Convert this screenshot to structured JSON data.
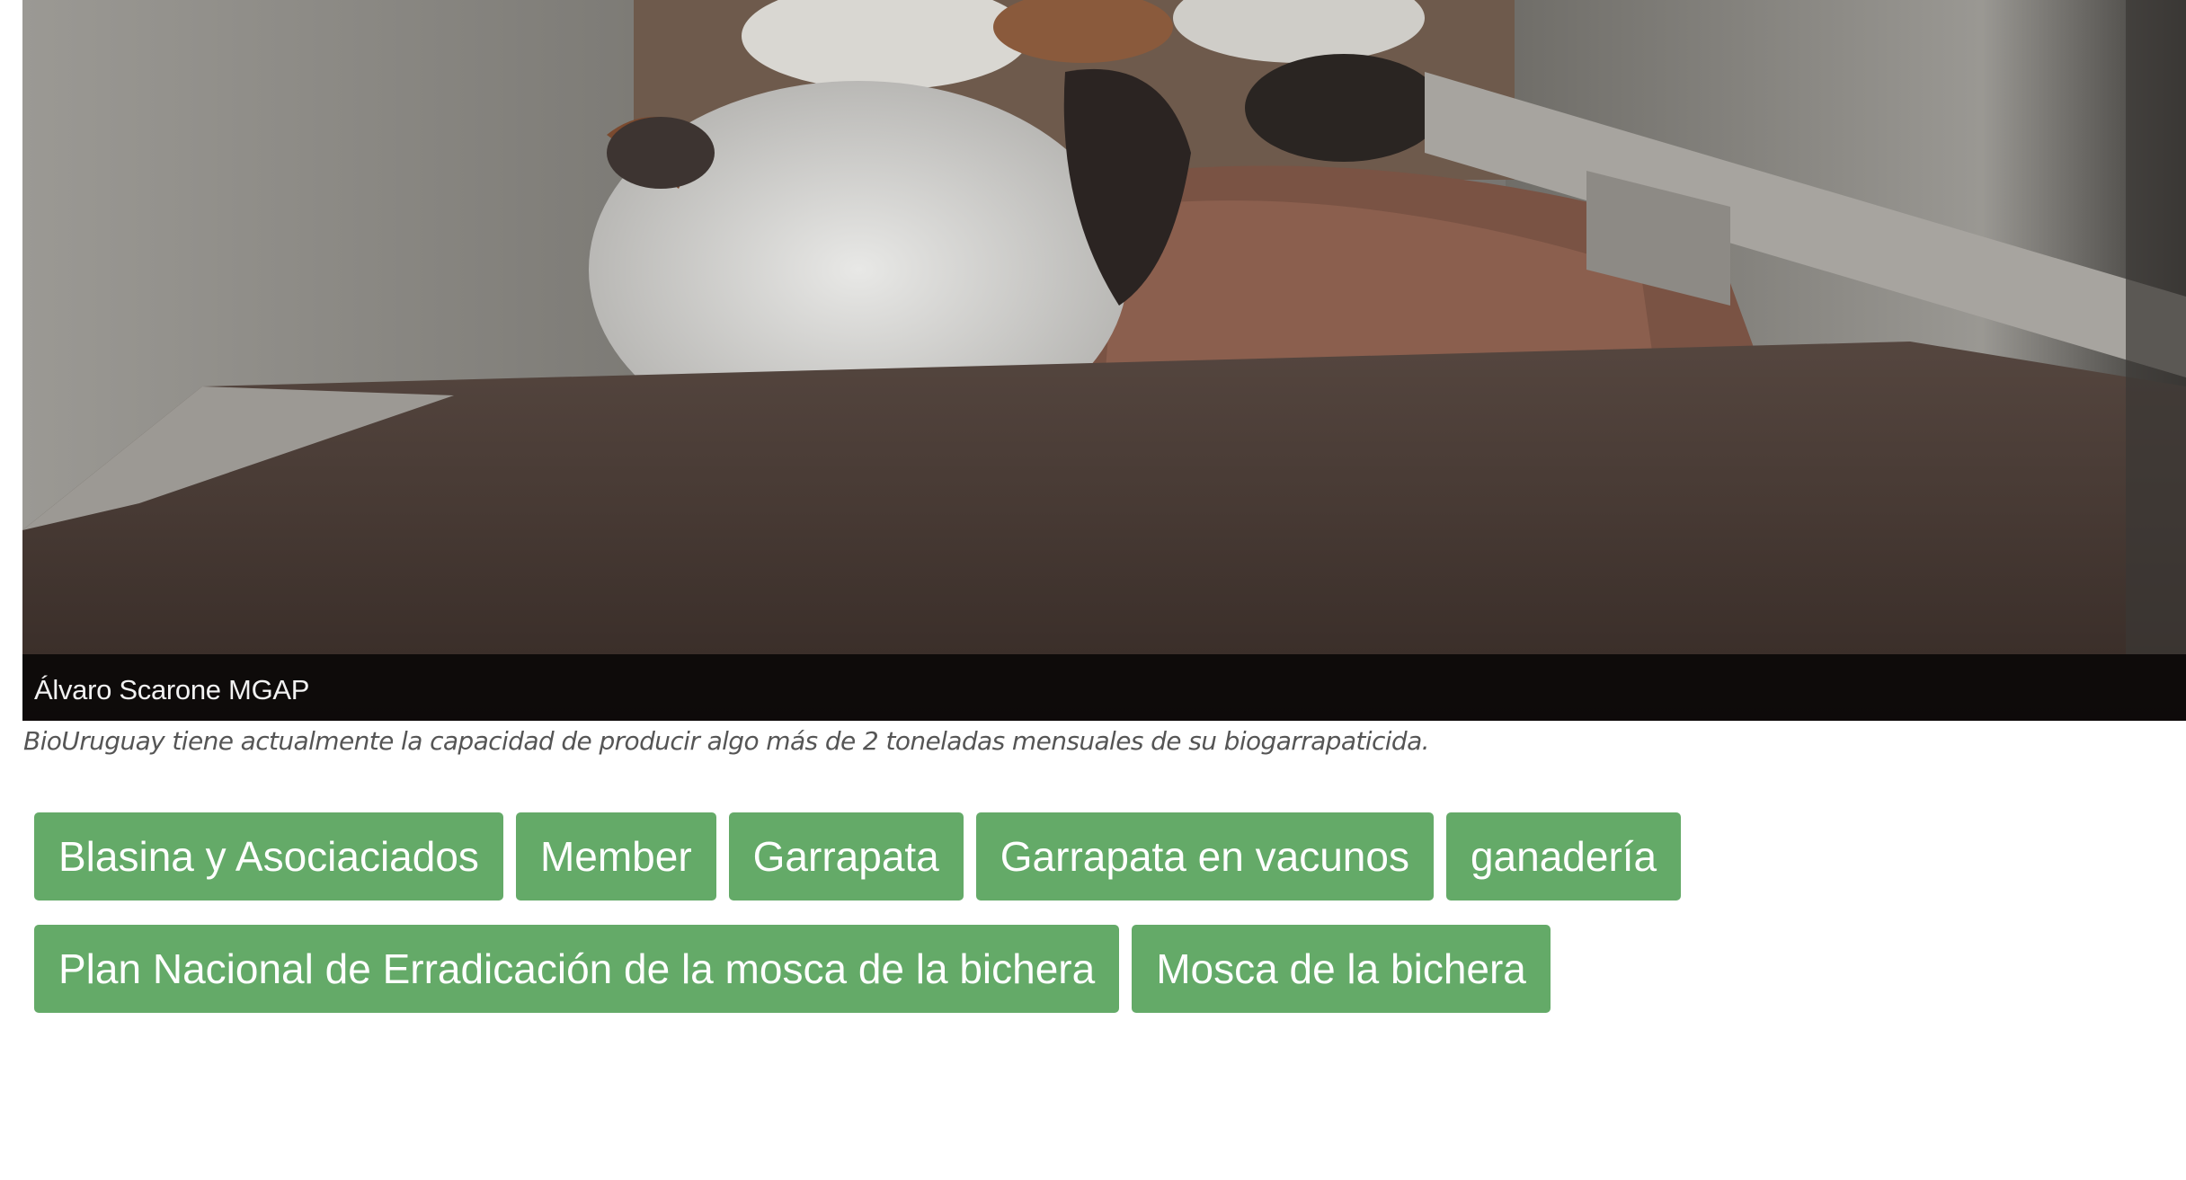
{
  "photo": {
    "credit": "Álvaro Scarone MGAP"
  },
  "caption": "BioUruguay tiene actualmente la capacidad de producir algo más de 2 toneladas mensuales de su biogarrapaticida.",
  "tags": {
    "row1": [
      "Blasina y Asociaciados",
      "Member",
      "Garrapata",
      "Garrapata en vacunos",
      "ganadería"
    ],
    "row2": [
      "Plan Nacional de Erradicación de la mosca de la bichera",
      "Mosca de la bichera"
    ]
  },
  "colors": {
    "tag_background": "#64aa68",
    "tag_text": "#ffffff",
    "caption_text": "#555555"
  }
}
